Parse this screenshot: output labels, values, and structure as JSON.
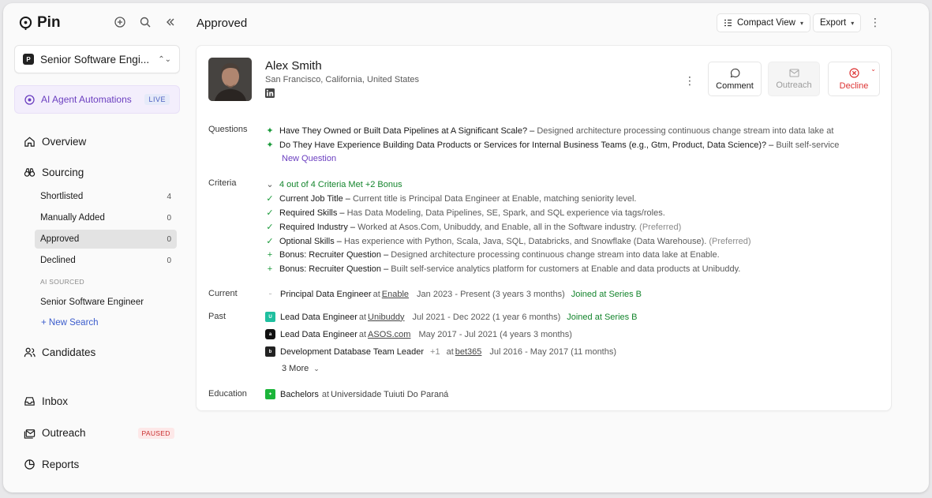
{
  "app": {
    "name": "Pin"
  },
  "sidebar": {
    "project": {
      "badge": "P",
      "name": "Senior Software Engi..."
    },
    "ai_automations": {
      "label": "AI Agent Automations",
      "badge": "LIVE"
    },
    "overview": "Overview",
    "sourcing": {
      "label": "Sourcing",
      "items": [
        {
          "label": "Shortlisted",
          "count": "4"
        },
        {
          "label": "Manually Added",
          "count": "0"
        },
        {
          "label": "Approved",
          "count": "0"
        },
        {
          "label": "Declined",
          "count": "0"
        }
      ],
      "ai_sourced_label": "AI SOURCED",
      "ai_sourced_item": "Senior Software Engineer",
      "new_search": "+ New Search"
    },
    "candidates": "Candidates",
    "inbox": "Inbox",
    "outreach": {
      "label": "Outreach",
      "badge": "PAUSED"
    },
    "reports": "Reports"
  },
  "header": {
    "title": "Approved",
    "view_button": "Compact View",
    "export_button": "Export"
  },
  "candidate": {
    "name": "Alex Smith",
    "location": "San Francisco, California, United States",
    "actions": {
      "comment": "Comment",
      "outreach": "Outreach",
      "decline": "Decline"
    },
    "labels": {
      "questions": "Questions",
      "criteria": "Criteria",
      "current": "Current",
      "past": "Past",
      "education": "Education"
    },
    "questions": [
      {
        "q": "Have They Owned or Built Data Pipelines at A Significant Scale? –",
        "a": "Designed architecture processing continuous change stream into data lake at"
      },
      {
        "q": "Do They Have Experience Building Data Products or Services for Internal Business Teams (e.g., Gtm, Product, Data Science)? –",
        "a": "Built self-service"
      }
    ],
    "new_question": "New Question",
    "criteria_summary": "4 out of 4 Criteria Met +2 Bonus",
    "criteria": [
      {
        "title": "Current Job Title –",
        "text": "Current title is Principal Data Engineer at Enable, matching seniority level.",
        "pref": ""
      },
      {
        "title": "Required Skills –",
        "text": "Has Data Modeling, Data Pipelines, SE, Spark, and SQL experience via tags/roles.",
        "pref": ""
      },
      {
        "title": "Required Industry –",
        "text": "Worked at Asos.Com, Unibuddy, and Enable, all in the Software industry.",
        "pref": "(Preferred)"
      },
      {
        "title": "Optional Skills –",
        "text": "Has experience with Python, Scala, Java, SQL, Databricks, and Snowflake (Data Warehouse).",
        "pref": "(Preferred)"
      },
      {
        "title": "Bonus: Recruiter Question –",
        "text": "Designed architecture processing continuous change stream into data lake at Enable.",
        "pref": ""
      },
      {
        "title": "Bonus: Recruiter Question –",
        "text": "Built self-service analytics platform for customers at Enable and data products at Unibuddy.",
        "pref": ""
      }
    ],
    "current": {
      "role": "Principal Data Engineer",
      "at": "at",
      "company": "Enable",
      "dates": "Jan 2023 - Present (3 years 3 months)",
      "note": "Joined at Series B",
      "logo": "enable"
    },
    "past": [
      {
        "role": "Lead Data Engineer",
        "at": "at",
        "company": "Unibuddy",
        "dates": "Jul 2021 - Dec 2022 (1 year 6 months)",
        "note": "Joined at Series B",
        "extra": ""
      },
      {
        "role": "Lead Data Engineer",
        "at": "at",
        "company": "ASOS.com",
        "dates": "May 2017 - Jul 2021 (4 years 3 months)",
        "note": "",
        "extra": ""
      },
      {
        "role": "Development Database Team Leader",
        "at": "at",
        "company": "bet365",
        "dates": "Jul 2016 - May 2017 (11 months)",
        "note": "",
        "extra": "+1"
      }
    ],
    "more": "3 More",
    "education": {
      "degree": "Bachelors",
      "at": "at",
      "school": "Universidade Tuiuti Do Paraná"
    }
  },
  "colors": {
    "accent_purple": "#6b3fc0",
    "green": "#14852d",
    "decline_red": "#dd3333",
    "link_blue": "#3b5ccc"
  }
}
